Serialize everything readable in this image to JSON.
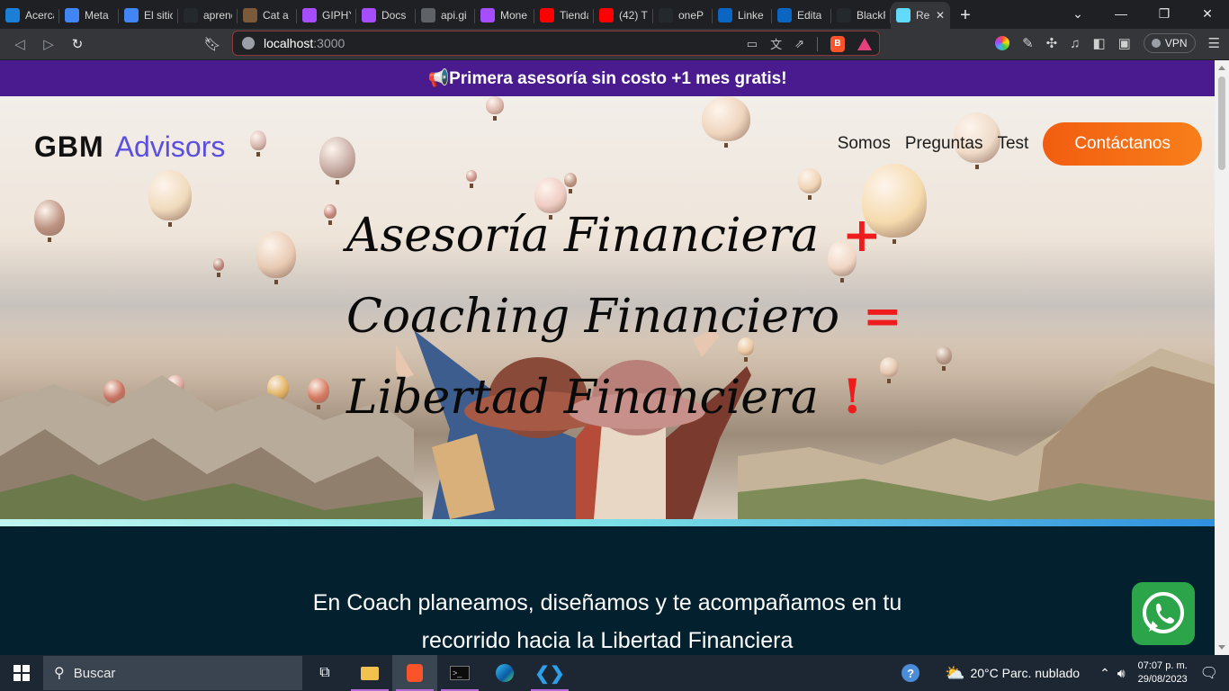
{
  "browser": {
    "tabs": [
      {
        "title": "Acerca",
        "icon": "edge-icon",
        "color": "#1b7fd8"
      },
      {
        "title": "Meta",
        "icon": "google-icon",
        "color": "#4285f4"
      },
      {
        "title": "El sitio",
        "icon": "google-icon",
        "color": "#4285f4"
      },
      {
        "title": "aprende",
        "icon": "github-icon",
        "color": "#24292e"
      },
      {
        "title": "Cat a",
        "icon": "image-icon",
        "color": "#7a5a3a"
      },
      {
        "title": "GIPHY",
        "icon": "doc-icon",
        "color": "#a64dff"
      },
      {
        "title": "Docs",
        "icon": "doc-icon",
        "color": "#a64dff"
      },
      {
        "title": "api.gi",
        "icon": "globe-icon",
        "color": "#5f6368"
      },
      {
        "title": "Mone",
        "icon": "doc-icon",
        "color": "#a64dff"
      },
      {
        "title": "Tienda",
        "icon": "youtube-icon",
        "color": "#ff0000"
      },
      {
        "title": "(42) T",
        "icon": "youtube-icon",
        "color": "#ff0000"
      },
      {
        "title": "oneP",
        "icon": "github-icon",
        "color": "#24292e"
      },
      {
        "title": "Linke",
        "icon": "linkedin-icon",
        "color": "#0a66c2"
      },
      {
        "title": "Edita",
        "icon": "linkedin-icon",
        "color": "#0a66c2"
      },
      {
        "title": "BlackF",
        "icon": "github-icon",
        "color": "#24292e"
      },
      {
        "title": "Re",
        "icon": "react-icon",
        "color": "#61dafb",
        "active": true
      }
    ],
    "url_host": "localhost",
    "url_port": ":3000",
    "vpn_label": "VPN"
  },
  "page": {
    "promo_text": "📢Primera asesoría sin costo +1 mes gratis!",
    "brand": {
      "bold": "GBM",
      "light": "Advisors"
    },
    "nav": {
      "somos": "Somos",
      "preguntas": "Preguntas",
      "test": "Test",
      "cta": "Contáctanos"
    },
    "headline": [
      {
        "text": "Asesoría Financiera",
        "symbol": "+"
      },
      {
        "text": "Coaching Financiero",
        "symbol": "="
      },
      {
        "text": "Libertad Financiera",
        "symbol": "!"
      }
    ],
    "tagline_1": "En Coach planeamos, diseñamos y te acompañamos en tu",
    "tagline_2": "recorrido hacia la Libertad Financiera"
  },
  "taskbar": {
    "search_placeholder": "Buscar",
    "weather": "20°C  Parc. nublado",
    "time": "07:07 p. m.",
    "date": "29/08/2023"
  },
  "colors": {
    "promo_bg": "#4a1b8f",
    "brand_accent": "#5b4fe0",
    "cta": "#f25d10",
    "content_bg": "#03202f",
    "whatsapp": "#2ca54a"
  }
}
